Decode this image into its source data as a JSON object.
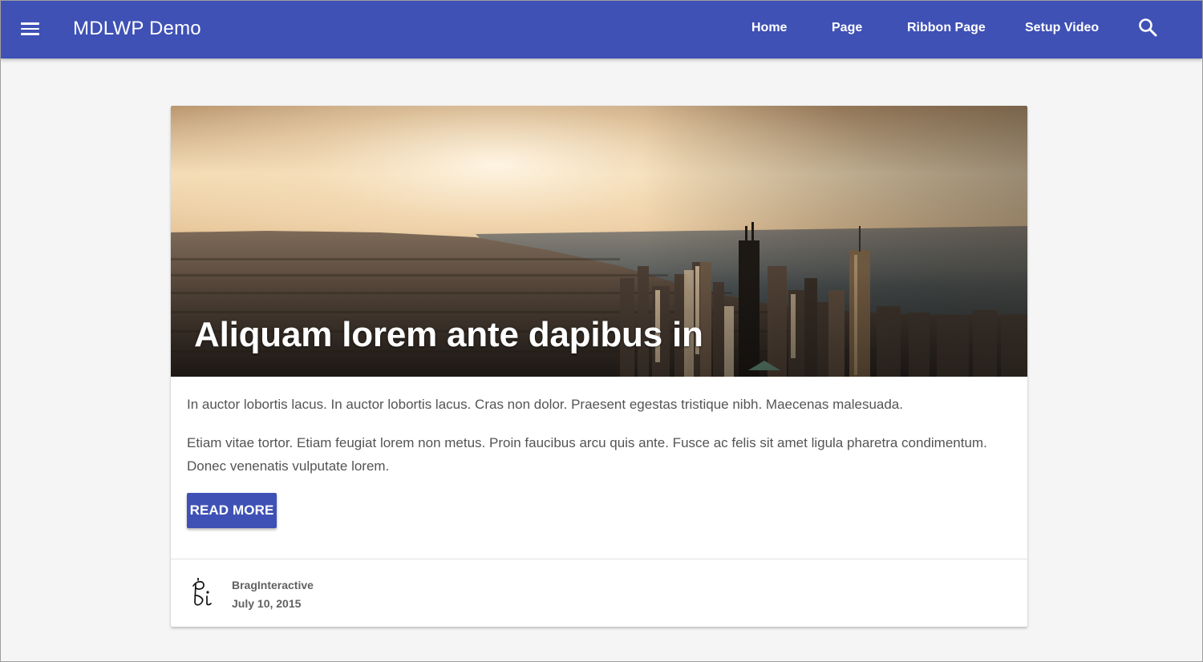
{
  "app": {
    "title": "MDLWP Demo",
    "accent_color": "#3f51b5",
    "menu_icon": "menu-icon",
    "search_icon": "search-icon"
  },
  "nav": {
    "items": [
      {
        "label": "Home"
      },
      {
        "label": "Page"
      },
      {
        "label": "Ribbon Page"
      },
      {
        "label": "Setup Video"
      }
    ]
  },
  "post": {
    "title": "Aliquam lorem ante dapibus in",
    "paragraphs": [
      "In auctor lobortis lacus. In auctor lobortis lacus. Cras non dolor. Praesent egestas tristique nibh. Maecenas malesuada.",
      "Etiam vitae tortor. Etiam feugiat lorem non metus. Proin faucibus arcu quis ante. Fusce ac felis sit amet ligula pharetra condimentum. Donec venenatis vulputate lorem."
    ],
    "read_more_label": "READ MORE",
    "author": "BragInteractive",
    "date": "July 10, 2015"
  }
}
